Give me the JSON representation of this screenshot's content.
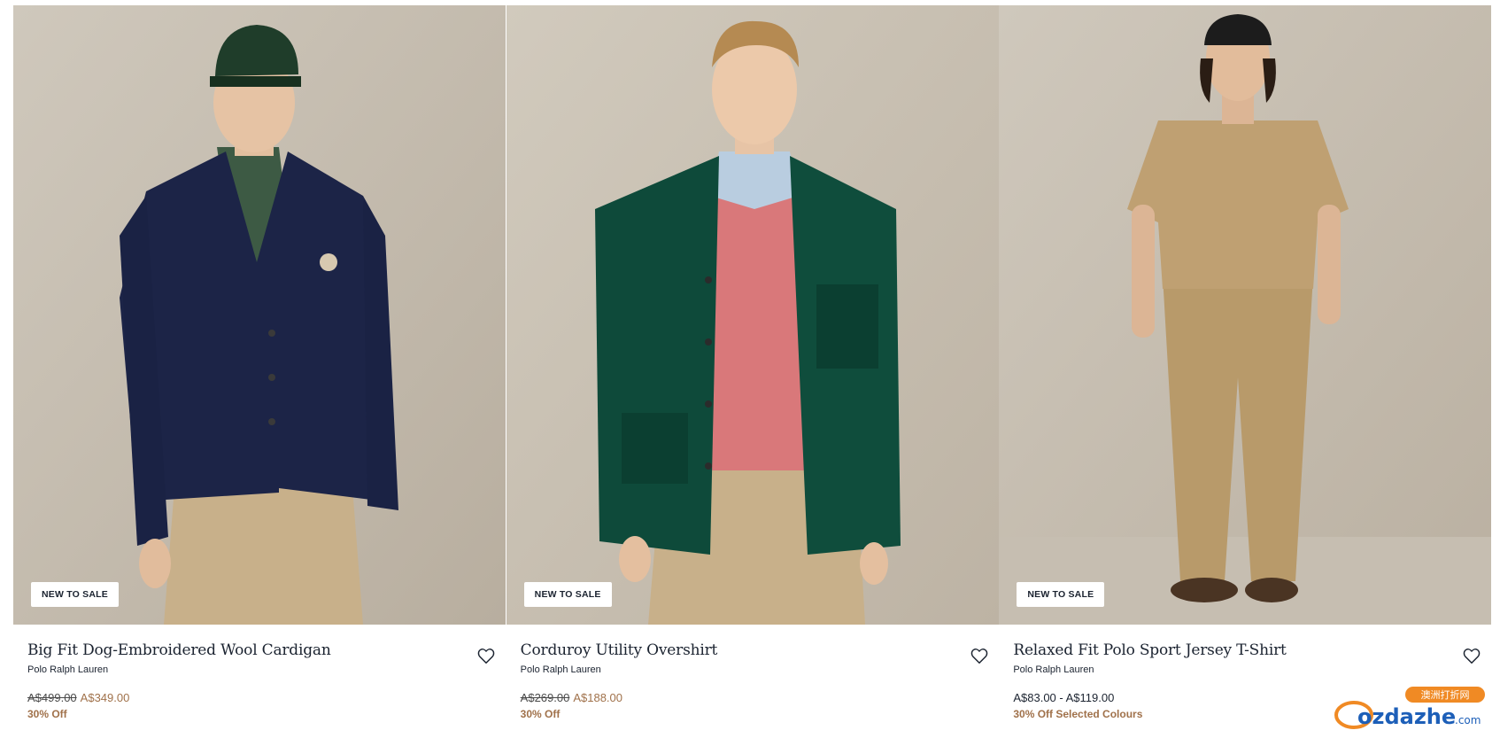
{
  "products": [
    {
      "badge": "NEW TO SALE",
      "title": "Big Fit Dog-Embroidered Wool Cardigan",
      "brand": "Polo Ralph Lauren",
      "was_price": "A$499.00",
      "now_price": "A$349.00",
      "discount": "30% Off"
    },
    {
      "badge": "NEW TO SALE",
      "title": "Corduroy Utility Overshirt",
      "brand": "Polo Ralph Lauren",
      "was_price": "A$269.00",
      "now_price": "A$188.00",
      "discount": "30% Off"
    },
    {
      "badge": "NEW TO SALE",
      "title": "Relaxed Fit Polo Sport Jersey T-Shirt",
      "brand": "Polo Ralph Lauren",
      "price_range": "A$83.00 - A$119.00",
      "discount": "30% Off Selected Colours"
    }
  ],
  "watermark": {
    "top_text": "澳洲打折网",
    "brand_text": "ozdazhe",
    "suffix": ".com"
  },
  "colors": {
    "sale_price": "#a0714a",
    "text_primary": "#1b2330",
    "cardigan": "#1c2447",
    "overshirt": "#0e4a3a",
    "sweater": "#d9787a",
    "khaki": "#c8b08a",
    "backdrop": "#c4bcae"
  }
}
